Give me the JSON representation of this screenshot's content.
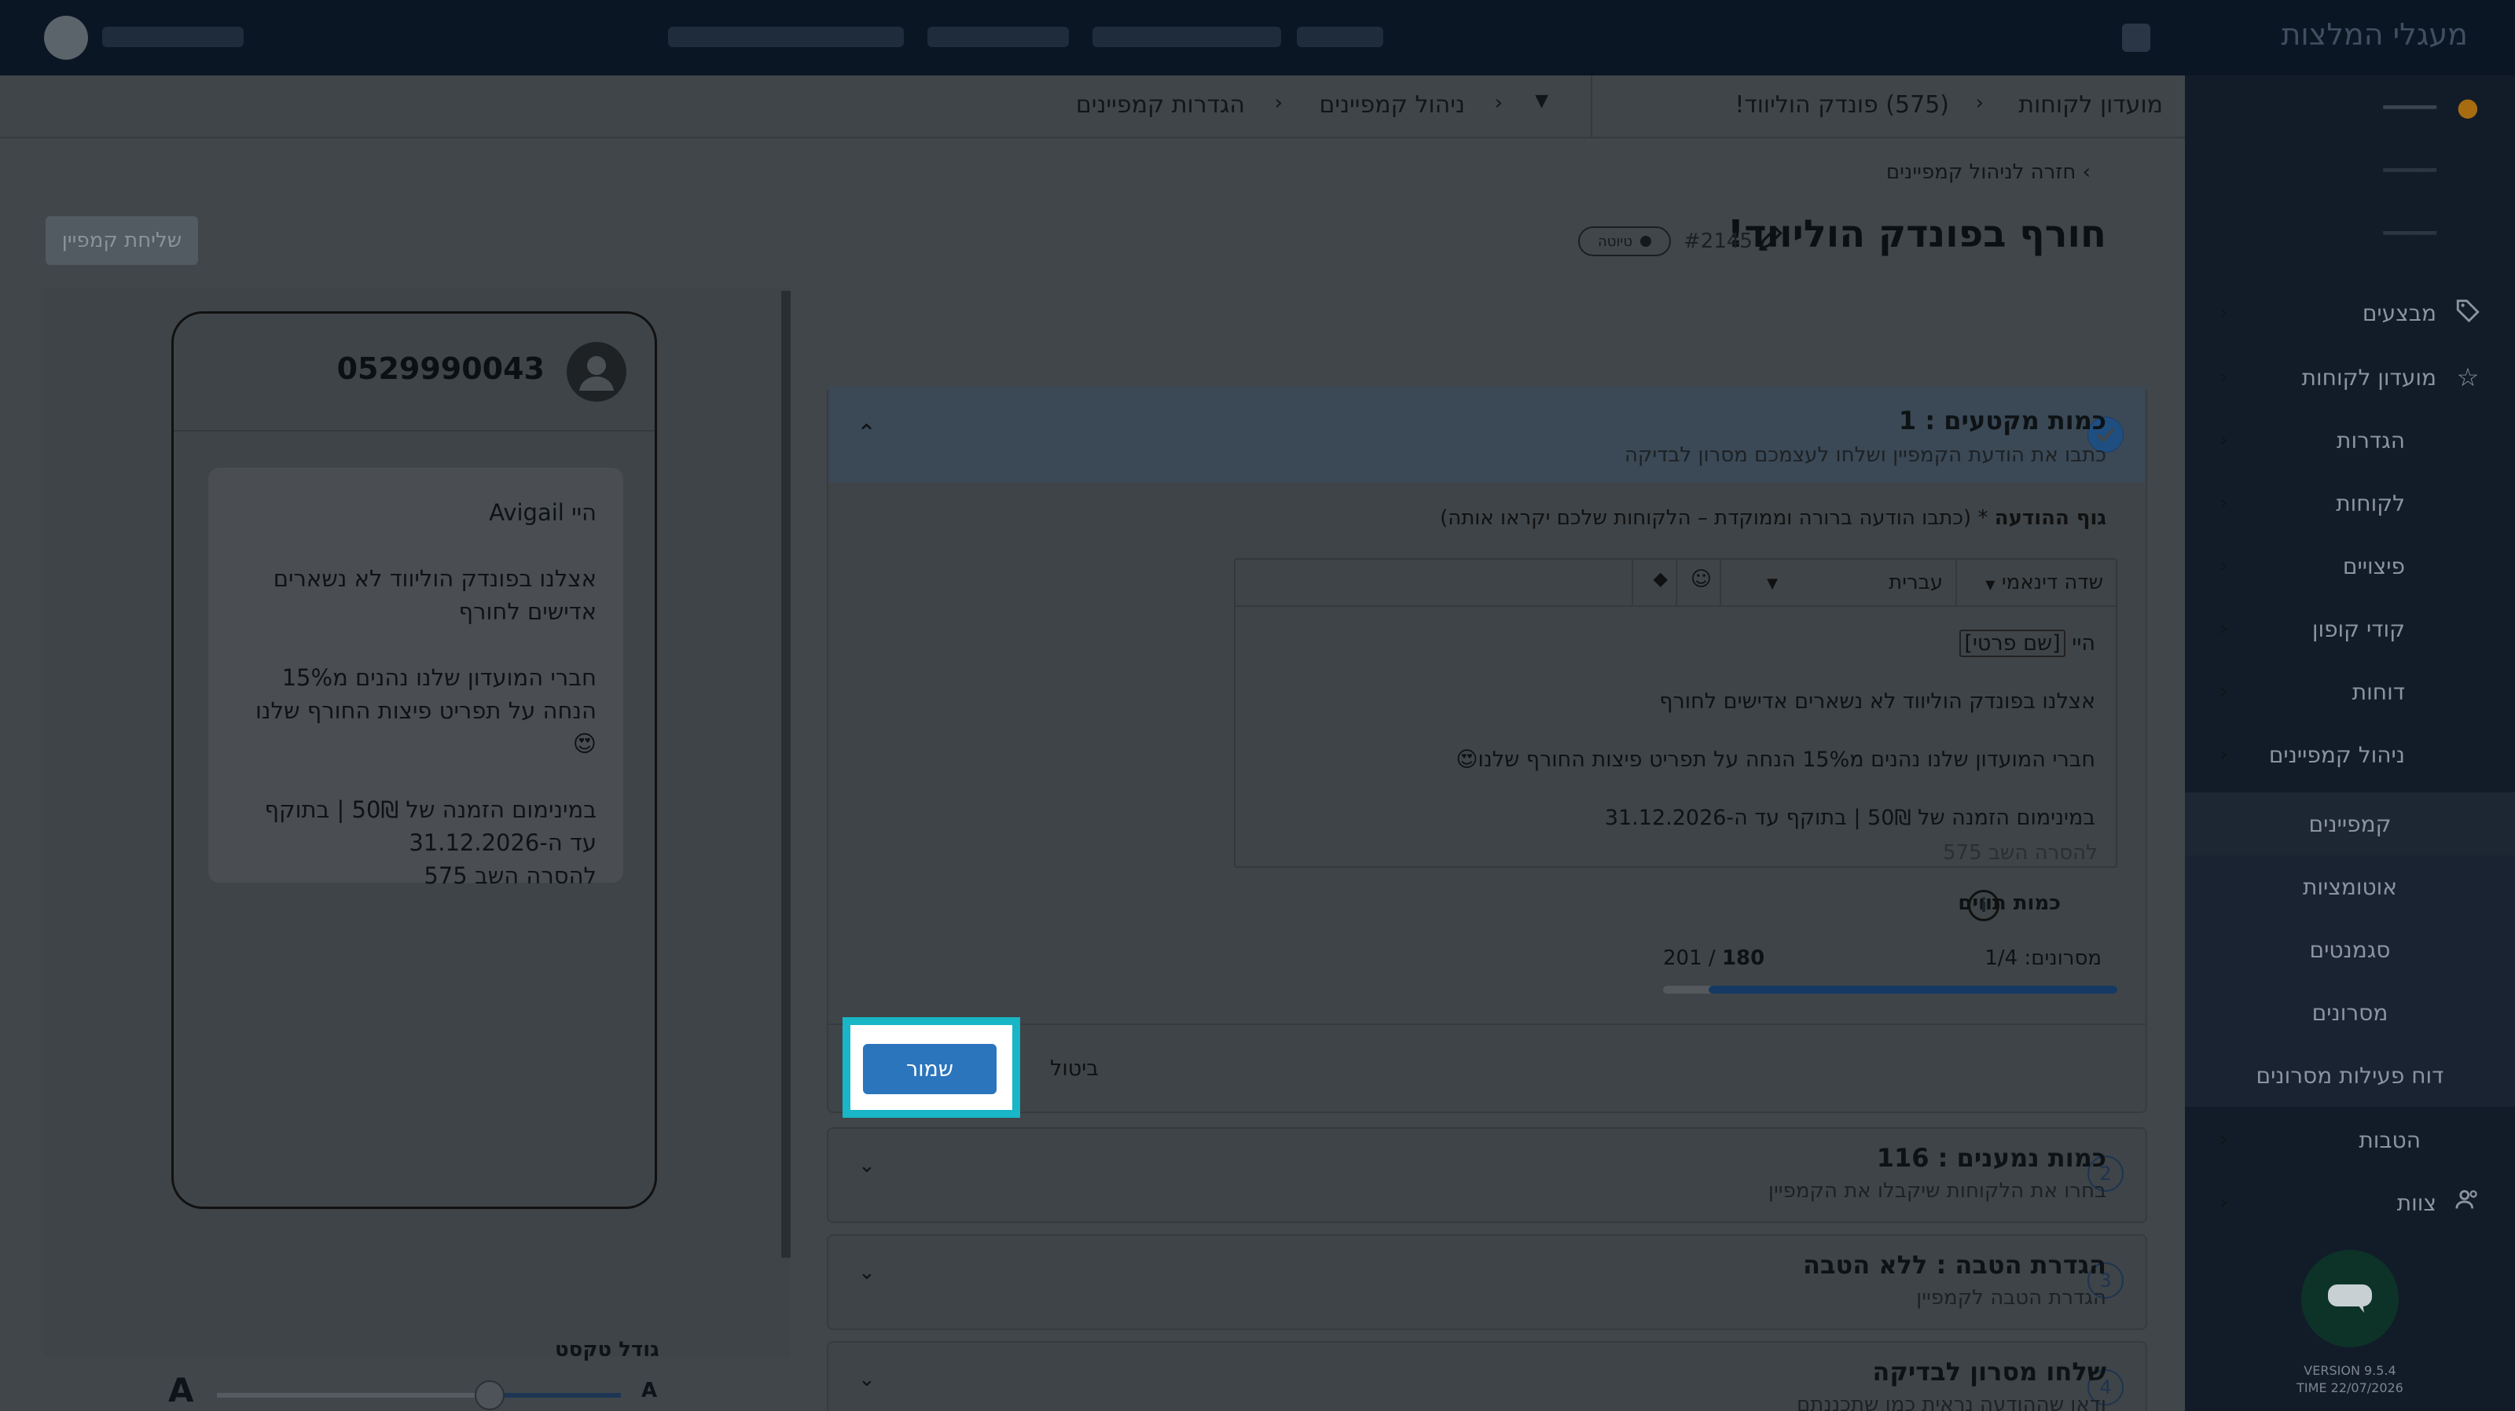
{
  "topbar": {
    "brand": "מעגלי המלצות"
  },
  "breadcrumb": {
    "root": "מועדון לקוחות",
    "business": "(575) פונדק הוליווד!",
    "section": "ניהול קמפיינים",
    "current": "הגדרות קמפיינים"
  },
  "back_link": "חזרה לניהול קמפיינים",
  "campaign": {
    "title": "חורף בפונדק הוליווד!",
    "id": "#2145",
    "status": "טיוטה"
  },
  "send_button": "שליחת קמפיין",
  "sidebar": {
    "items": [
      {
        "label": "מבצעים",
        "icon": "tag-icon"
      },
      {
        "label": "מועדון לקוחות",
        "icon": "star-icon"
      },
      {
        "label": "הגדרות"
      },
      {
        "label": "לקוחות"
      },
      {
        "label": "פיצויים"
      },
      {
        "label": "קודי קופון"
      },
      {
        "label": "דוחות"
      },
      {
        "label": "ניהול קמפיינים"
      }
    ],
    "sub_items": [
      "קמפיינים",
      "אוטומציות",
      "סגמנטים",
      "מסרונים",
      "דוח פעילות מסרונים"
    ],
    "bottom_items": [
      {
        "label": "הטבות"
      },
      {
        "label": "צוות",
        "icon": "team-icon"
      }
    ],
    "version": "VERSION 9.5.4",
    "time": "TIME 22/07/2026"
  },
  "step1": {
    "number": "1",
    "title": "כמות מקטעים : 1",
    "subtitle": "כתבו את הודעת הקמפיין ושלחו לעצמכם מסרון לבדיקה",
    "body_label": "גוף ההודעה",
    "body_hint": "* (כתבו הודעה ברורה וממוקדת – הלקוחות שלכם יקראו אותה)",
    "toolbar": {
      "dynamic_field": "שדה דינאמי",
      "language": "עברית"
    },
    "message": {
      "greeting": "היי",
      "name_tag": "[שם פרטי]",
      "line2": "אצלנו בפונדק הוליווד לא נשארים אדישים לחורף",
      "line3": "חברי המועדון שלנו נהנים מ15% הנחה על תפריט פיצות החורף שלנו😍",
      "line4": "במינימום הזמנה של 50₪ | בתוקף עד ה-31.12.2026",
      "unsubscribe": "להסרה השב 575"
    },
    "char_label": "כמות תווים",
    "messages_count": "מסרונים: 1/4",
    "chars_used": "180",
    "chars_total": "201",
    "progress": 0.9,
    "save": "שמור",
    "cancel": "ביטול"
  },
  "step2": {
    "number": "2",
    "title": "כמות נמענים : 116",
    "subtitle": "בחרו את הלקוחות שיקבלו את הקמפיין"
  },
  "step3": {
    "number": "3",
    "title": "הגדרת הטבה : ללא הטבה",
    "subtitle": "הגדרת הטבה לקמפיין"
  },
  "step4": {
    "number": "4",
    "title": "שלחו מסרון לבדיקה",
    "subtitle": "ודאו שההודעה נראית כמו שתכננתם"
  },
  "preview": {
    "phone_number": "0529990043",
    "greeting": "היי Avigail",
    "line2": "אצלנו בפונדק הוליווד לא נשארים אדישים לחורף",
    "line3": "חברי המועדון שלנו נהנים מ15% הנחה על תפריט פיצות החורף שלנו😍",
    "line4": "במינימום הזמנה של 50₪ | בתוקף עד ה-31.12.2026",
    "line5": "להסרה השב 575",
    "text_size_label": "גודל טקסט",
    "size_small": "A",
    "size_large": "A"
  }
}
